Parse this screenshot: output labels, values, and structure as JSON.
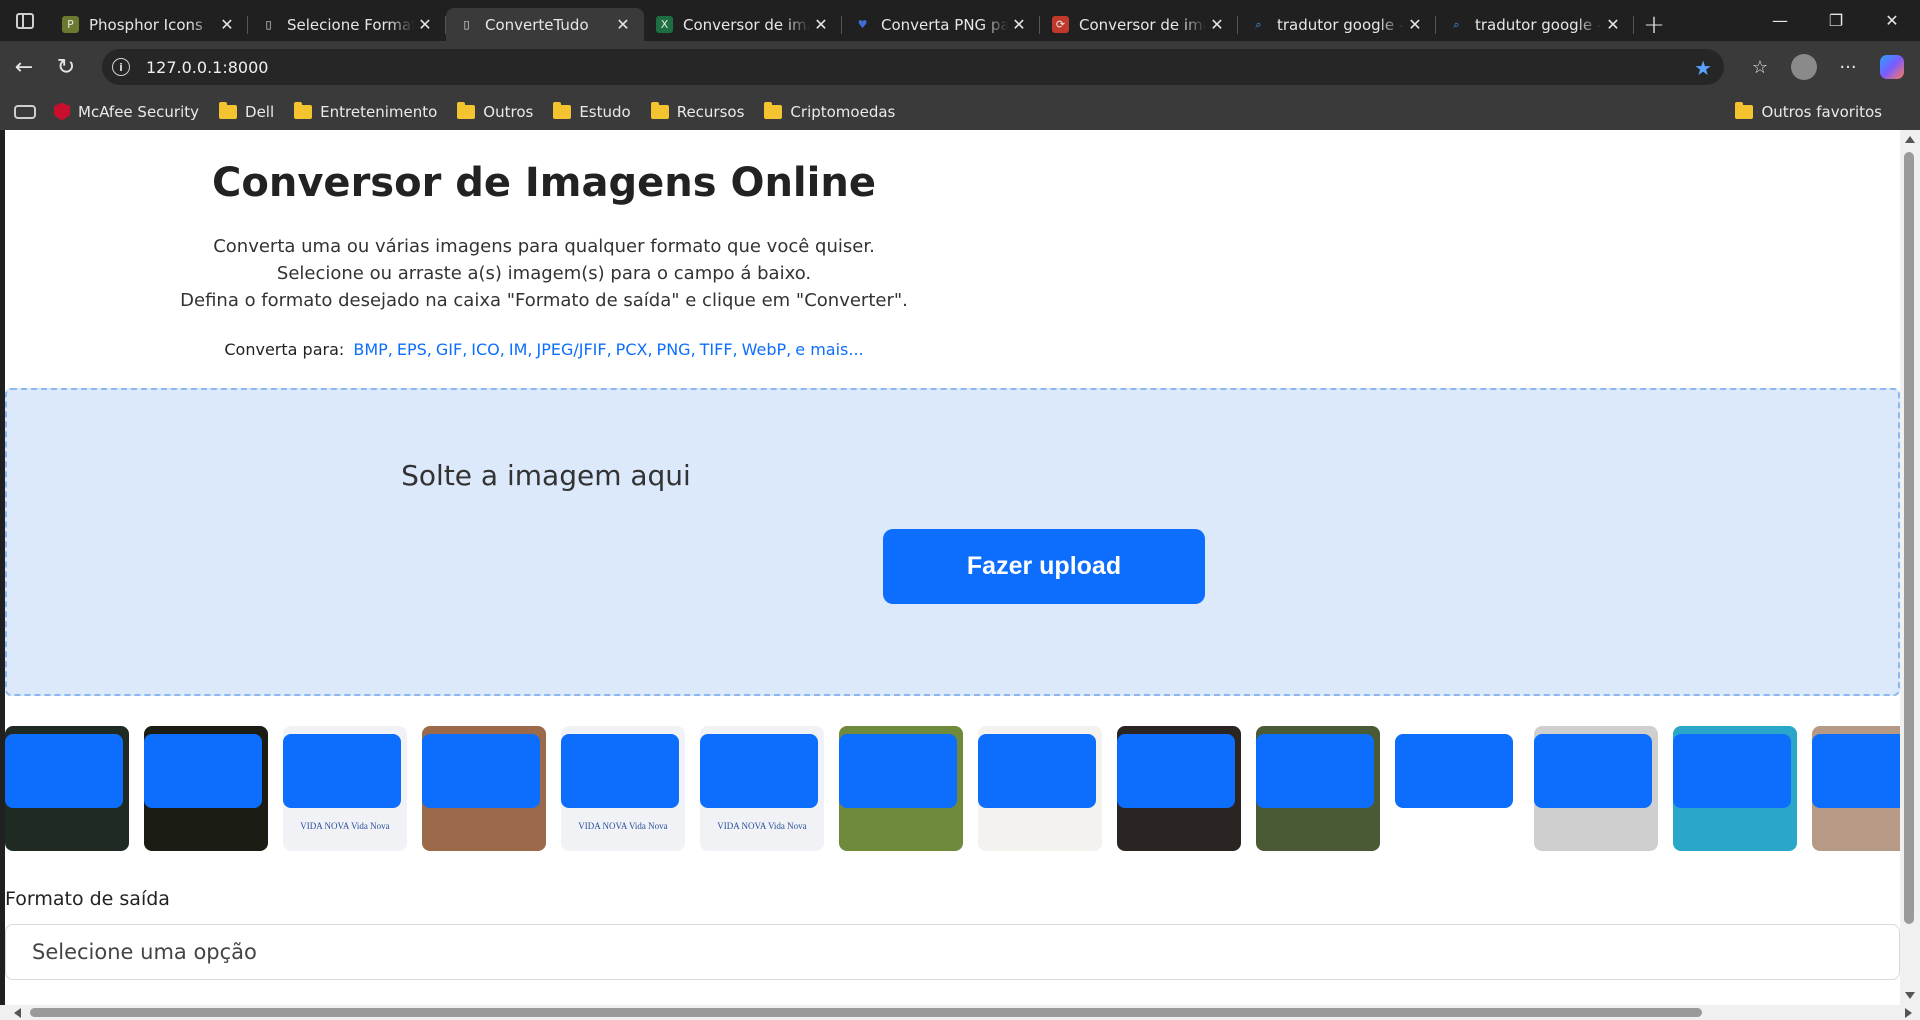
{
  "browser": {
    "tabs": [
      {
        "title": "Phosphor Icons",
        "favicon": "phosphor-icon",
        "active": false
      },
      {
        "title": "Selecione Formato",
        "favicon": "page-icon",
        "active": false
      },
      {
        "title": "ConverteTudo",
        "favicon": "page-icon",
        "active": true
      },
      {
        "title": "Conversor de imagens",
        "favicon": "excel-icon",
        "active": false
      },
      {
        "title": "Converta PNG para",
        "favicon": "heart-icon",
        "active": false
      },
      {
        "title": "Conversor de imagens",
        "favicon": "convert-icon",
        "active": false
      },
      {
        "title": "tradutor google - Pesquisar",
        "favicon": "search-icon",
        "active": false
      },
      {
        "title": "tradutor google - Pesquisar",
        "favicon": "search-icon",
        "active": false
      }
    ],
    "url": "127.0.0.1:8000",
    "bookmarks": [
      {
        "label": "McAfee Security",
        "icon": "mcafee-icon"
      },
      {
        "label": "Dell",
        "icon": "folder-icon"
      },
      {
        "label": "Entretenimento",
        "icon": "folder-icon"
      },
      {
        "label": "Outros",
        "icon": "folder-icon"
      },
      {
        "label": "Estudo",
        "icon": "folder-icon"
      },
      {
        "label": "Recursos",
        "icon": "folder-icon"
      },
      {
        "label": "Criptomoedas",
        "icon": "folder-icon"
      }
    ],
    "other_favorites": "Outros favoritos"
  },
  "page": {
    "title": "Conversor de Imagens Online",
    "description": [
      "Converta uma ou várias imagens para qualquer formato que você quiser.",
      "Selecione ou arraste a(s) imagem(s) para o campo á baixo.",
      "Defina o formato desejado na caixa \"Formato de saída\" e clique em \"Converter\"."
    ],
    "convert_to_label": "Converta para:",
    "formats": [
      "BMP,",
      "EPS,",
      "GIF,",
      "ICO,",
      "IM,",
      "JPEG/JFIF,",
      "PCX,",
      "PNG,",
      "TIFF,",
      "WebP,",
      "e mais..."
    ],
    "drop_hint": "Solte a imagem aqui",
    "upload_button": "Fazer upload",
    "thumbnails": [
      {
        "bg": "#1f2b22",
        "logo": ""
      },
      {
        "bg": "#1b1d14",
        "logo": ""
      },
      {
        "bg": "#f1f2f5",
        "logo": "VIDA NOVA  Vida Nova"
      },
      {
        "bg": "#9a6a4a",
        "logo": ""
      },
      {
        "bg": "#f1f2f5",
        "logo": "VIDA NOVA  Vida Nova"
      },
      {
        "bg": "#f1f2f5",
        "logo": "VIDA NOVA  Vida Nova"
      },
      {
        "bg": "#6e8a3a",
        "logo": ""
      },
      {
        "bg": "#f4f2ee",
        "logo": ""
      },
      {
        "bg": "#2a2422",
        "logo": ""
      },
      {
        "bg": "#4a5a34",
        "logo": ""
      },
      {
        "bg": "#ffffff",
        "logo": ""
      },
      {
        "bg": "#cfcfcf",
        "logo": ""
      },
      {
        "bg": "#2aa6c9",
        "logo": ""
      },
      {
        "bg": "#b79a86",
        "logo": ""
      }
    ],
    "output_format_label": "Formato de saída",
    "output_format_placeholder": "Selecione uma opção"
  }
}
